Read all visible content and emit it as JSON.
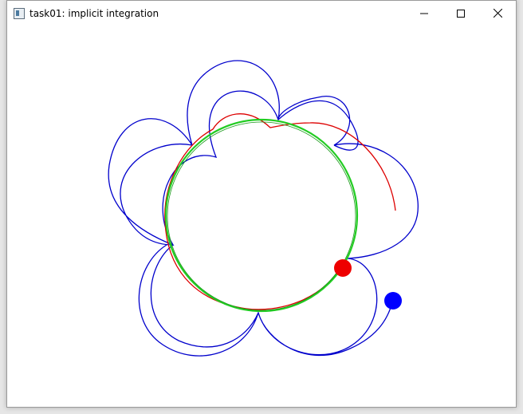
{
  "window": {
    "title": "task01: implicit integration",
    "icon": "app-window-icon",
    "controls": [
      "minimize-icon",
      "maximize-icon",
      "close-icon"
    ]
  },
  "scene": {
    "background": "#ffffff",
    "colors": {
      "trajectory_implicit": "#0000cc",
      "trajectory_explicit": "#dd0000",
      "constraint_circle": "#22cc22",
      "particle_blue": "#0000ff",
      "particle_red": "#ee0000"
    }
  }
}
